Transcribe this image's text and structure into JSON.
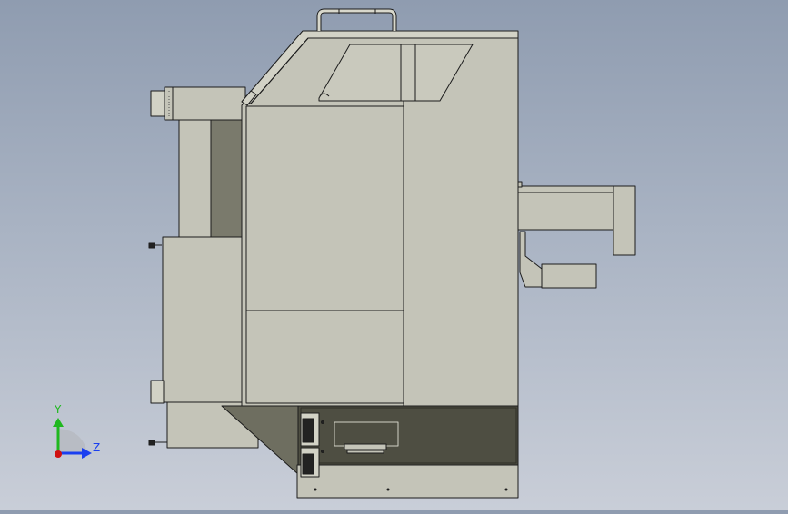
{
  "viewport": {
    "background_top": "#8f9cb0",
    "background_bottom": "#c9ced8"
  },
  "model": {
    "body_color": "#c4c4b8",
    "body_light": "#d2d2c6",
    "shadow_color": "#7a7a6c",
    "dark_color": "#4e4e42",
    "edge_color": "#1c1c1c"
  },
  "triad": {
    "y_label": "Y",
    "z_label": "Z",
    "y_color": "#1fb81f",
    "z_color": "#1a3ff0",
    "origin_color": "#d01010"
  }
}
